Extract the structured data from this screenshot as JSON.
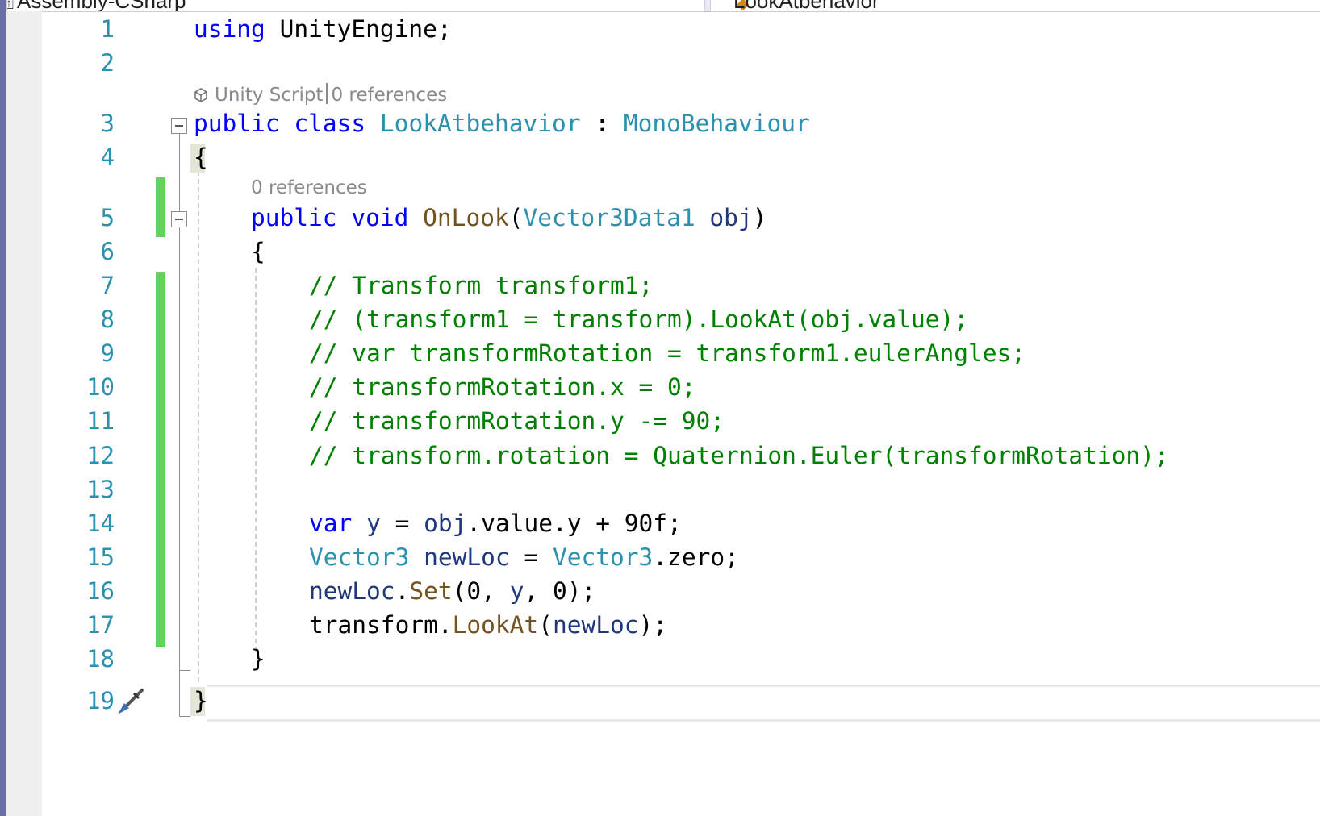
{
  "navbar": {
    "project": "Assembly-CSharp",
    "member": "LookAtbehavior",
    "project_icon": "project-icon",
    "member_icon": "class-icon"
  },
  "line_numbers": [
    "1",
    "2",
    "3",
    "4",
    "5",
    "6",
    "7",
    "8",
    "9",
    "10",
    "11",
    "12",
    "13",
    "14",
    "15",
    "16",
    "17",
    "18",
    "19"
  ],
  "codelens": {
    "class_lens_script": "Unity Script",
    "class_lens_refs": "0 references",
    "method_lens_refs": "0 references"
  },
  "code": {
    "l1": {
      "using": "using",
      "ns": " UnityEngine;"
    },
    "l3": {
      "public": "public",
      "class": "class",
      "name": "LookAtbehavior",
      "colon": " : ",
      "base": "MonoBehaviour"
    },
    "l4": "{",
    "l5": {
      "public": "public",
      "void": "void",
      "method": "OnLook",
      "open": "(",
      "ptype": "Vector3Data1",
      "param": "obj",
      "close": ")"
    },
    "l6": "{",
    "l7": "// Transform transform1;",
    "l8": "// (transform1 = transform).LookAt(obj.value);",
    "l9": "// var transformRotation = transform1.eulerAngles;",
    "l10": "// transformRotation.x = 0;",
    "l11": "// transformRotation.y -= 90;",
    "l12": "// transform.rotation = Quaternion.Euler(transformRotation);",
    "l14": {
      "var": "var",
      "y": "y",
      "eq": " = ",
      "obj": "obj",
      "rest": ".value.y + 90f;"
    },
    "l15": {
      "type1": "Vector3",
      "local": "newLoc",
      "eq": " = ",
      "type2": "Vector3",
      "rest": ".zero;"
    },
    "l16": {
      "local": "newLoc",
      "dot": ".",
      "method": "Set",
      "a": "(0, ",
      "y": "y",
      "b": ", 0);"
    },
    "l17": {
      "obj": "transform",
      "dot": ".",
      "method": "LookAt",
      "open": "(",
      "arg": "newLoc",
      "close": ");"
    },
    "l18": "}",
    "l19": "}"
  },
  "colors": {
    "keyword": "#0000ff",
    "type": "#2b91af",
    "method": "#74531f",
    "comment": "#008000",
    "local": "#1f377f",
    "change_bar": "#5fd35a"
  }
}
